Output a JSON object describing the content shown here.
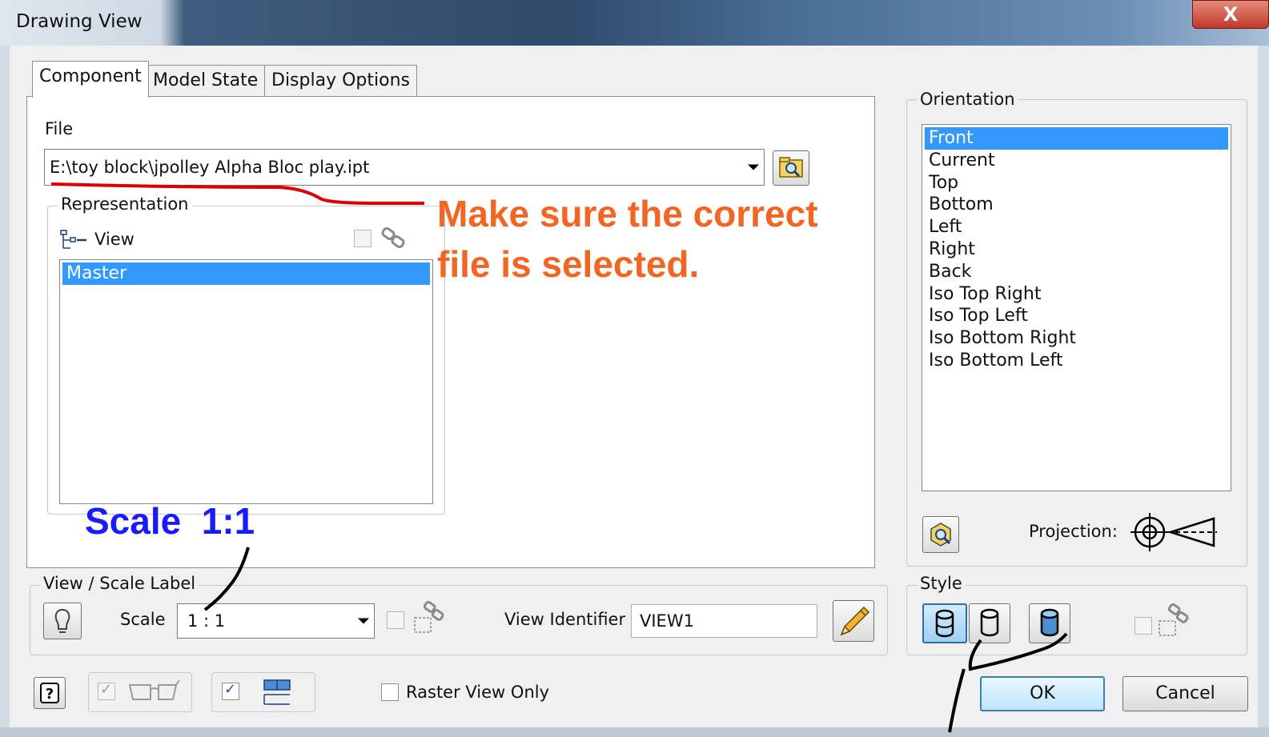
{
  "window": {
    "title": "Drawing View",
    "close_label": "X"
  },
  "tabs": [
    {
      "label": "Component",
      "active": true
    },
    {
      "label": "Model State",
      "active": false
    },
    {
      "label": "Display Options",
      "active": false
    }
  ],
  "component": {
    "file_label": "File",
    "file_value": "E:\\toy block\\jpolley Alpha Bloc play.ipt",
    "representation": {
      "title": "Representation",
      "view_label": "View",
      "items": [
        "Master"
      ],
      "selected": "Master"
    }
  },
  "orientation": {
    "title": "Orientation",
    "items": [
      "Front",
      "Current",
      "Top",
      "Bottom",
      "Left",
      "Right",
      "Back",
      "Iso Top Right",
      "Iso Top Left",
      "Iso Bottom Right",
      "Iso Bottom Left"
    ],
    "selected": "Front",
    "projection_label": "Projection:"
  },
  "view_scale_label": {
    "title": "View / Scale Label",
    "scale_label": "Scale",
    "scale_value": "1 : 1",
    "view_identifier_label": "View Identifier",
    "view_identifier_value": "VIEW1"
  },
  "style": {
    "title": "Style"
  },
  "bottom": {
    "raster_view_only_label": "Raster View Only",
    "raster_view_only_checked": false,
    "ok_label": "OK",
    "cancel_label": "Cancel"
  },
  "annotations": {
    "file_note_line1": "Make sure the correct",
    "file_note_line2": "file is selected.",
    "scale_note": "Scale  1:1",
    "colors": {
      "orange": "#f26522",
      "blue": "#1a1aff",
      "red": "#e00000"
    }
  },
  "selection_color": "#3399ff"
}
